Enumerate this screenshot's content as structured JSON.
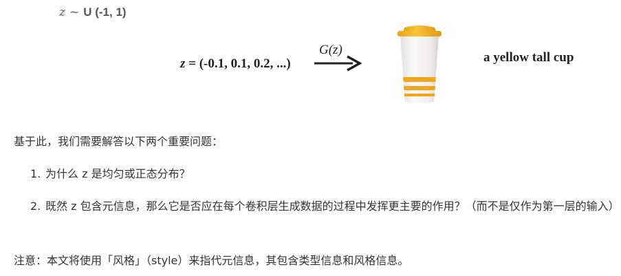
{
  "figure": {
    "distribution": {
      "variable": "z",
      "tilde": "~",
      "dist": "U (-1, 1)"
    },
    "sample": {
      "variable": "z",
      "values": " = (-0.1, 0.1, 0.2, ...)"
    },
    "generator_label": "G(z)",
    "image_description_label": "a yellow tall cup",
    "colors": {
      "cup_lid": "#f5b51c",
      "cup_stripe": "#f1a51b",
      "cup_body": "#f4f1f1"
    }
  },
  "intro": "基于此，我们需要解答以下两个重要问题：",
  "questions": [
    {
      "number": "1.",
      "text": "为什么 z 是均匀或正态分布？"
    },
    {
      "number": "2.",
      "text": "既然 z 包含元信息，那么它是否应在每个卷积层生成数据的过程中发挥更主要的作用？（而不是仅作为第一层的输入）"
    }
  ],
  "note": "注意：本文将使用「风格」（style）来指代元信息，其包含类型信息和风格信息。"
}
